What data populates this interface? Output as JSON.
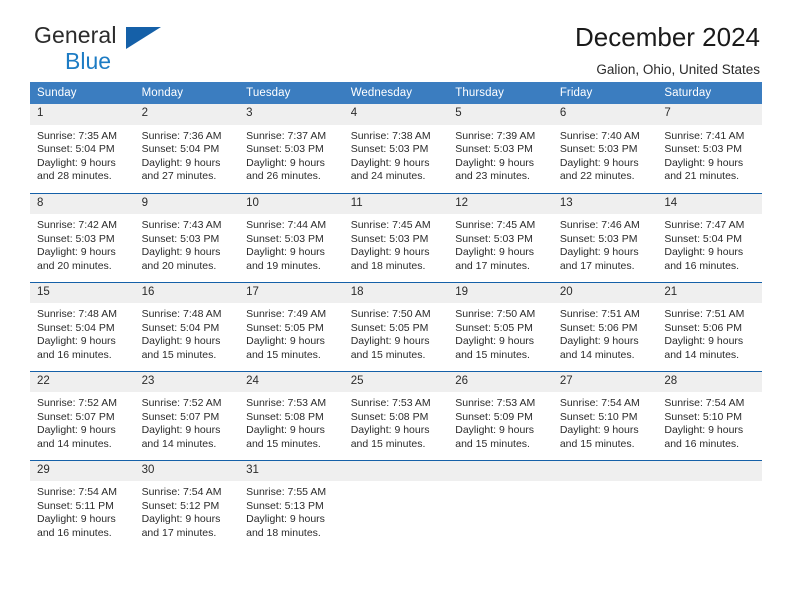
{
  "brand": {
    "name_part1": "General",
    "name_part2": "Blue",
    "triangle_color": "#1560a8",
    "blue_text_color": "#1d7cc4"
  },
  "header": {
    "title": "December 2024",
    "subtitle": "Galion, Ohio, United States"
  },
  "theme": {
    "header_row_bg": "#3b7dc0",
    "header_row_text": "#ffffff",
    "row_separator": "#1560a8",
    "daynum_bg": "#efefef"
  },
  "weekday_headers": [
    "Sunday",
    "Monday",
    "Tuesday",
    "Wednesday",
    "Thursday",
    "Friday",
    "Saturday"
  ],
  "labels": {
    "sunrise": "Sunrise:",
    "sunset": "Sunset:",
    "daylight": "Daylight:"
  },
  "weeks": [
    [
      {
        "day": "1",
        "sunrise": "Sunrise: 7:35 AM",
        "sunset": "Sunset: 5:04 PM",
        "daylight1": "Daylight: 9 hours",
        "daylight2": "and 28 minutes."
      },
      {
        "day": "2",
        "sunrise": "Sunrise: 7:36 AM",
        "sunset": "Sunset: 5:04 PM",
        "daylight1": "Daylight: 9 hours",
        "daylight2": "and 27 minutes."
      },
      {
        "day": "3",
        "sunrise": "Sunrise: 7:37 AM",
        "sunset": "Sunset: 5:03 PM",
        "daylight1": "Daylight: 9 hours",
        "daylight2": "and 26 minutes."
      },
      {
        "day": "4",
        "sunrise": "Sunrise: 7:38 AM",
        "sunset": "Sunset: 5:03 PM",
        "daylight1": "Daylight: 9 hours",
        "daylight2": "and 24 minutes."
      },
      {
        "day": "5",
        "sunrise": "Sunrise: 7:39 AM",
        "sunset": "Sunset: 5:03 PM",
        "daylight1": "Daylight: 9 hours",
        "daylight2": "and 23 minutes."
      },
      {
        "day": "6",
        "sunrise": "Sunrise: 7:40 AM",
        "sunset": "Sunset: 5:03 PM",
        "daylight1": "Daylight: 9 hours",
        "daylight2": "and 22 minutes."
      },
      {
        "day": "7",
        "sunrise": "Sunrise: 7:41 AM",
        "sunset": "Sunset: 5:03 PM",
        "daylight1": "Daylight: 9 hours",
        "daylight2": "and 21 minutes."
      }
    ],
    [
      {
        "day": "8",
        "sunrise": "Sunrise: 7:42 AM",
        "sunset": "Sunset: 5:03 PM",
        "daylight1": "Daylight: 9 hours",
        "daylight2": "and 20 minutes."
      },
      {
        "day": "9",
        "sunrise": "Sunrise: 7:43 AM",
        "sunset": "Sunset: 5:03 PM",
        "daylight1": "Daylight: 9 hours",
        "daylight2": "and 20 minutes."
      },
      {
        "day": "10",
        "sunrise": "Sunrise: 7:44 AM",
        "sunset": "Sunset: 5:03 PM",
        "daylight1": "Daylight: 9 hours",
        "daylight2": "and 19 minutes."
      },
      {
        "day": "11",
        "sunrise": "Sunrise: 7:45 AM",
        "sunset": "Sunset: 5:03 PM",
        "daylight1": "Daylight: 9 hours",
        "daylight2": "and 18 minutes."
      },
      {
        "day": "12",
        "sunrise": "Sunrise: 7:45 AM",
        "sunset": "Sunset: 5:03 PM",
        "daylight1": "Daylight: 9 hours",
        "daylight2": "and 17 minutes."
      },
      {
        "day": "13",
        "sunrise": "Sunrise: 7:46 AM",
        "sunset": "Sunset: 5:03 PM",
        "daylight1": "Daylight: 9 hours",
        "daylight2": "and 17 minutes."
      },
      {
        "day": "14",
        "sunrise": "Sunrise: 7:47 AM",
        "sunset": "Sunset: 5:04 PM",
        "daylight1": "Daylight: 9 hours",
        "daylight2": "and 16 minutes."
      }
    ],
    [
      {
        "day": "15",
        "sunrise": "Sunrise: 7:48 AM",
        "sunset": "Sunset: 5:04 PM",
        "daylight1": "Daylight: 9 hours",
        "daylight2": "and 16 minutes."
      },
      {
        "day": "16",
        "sunrise": "Sunrise: 7:48 AM",
        "sunset": "Sunset: 5:04 PM",
        "daylight1": "Daylight: 9 hours",
        "daylight2": "and 15 minutes."
      },
      {
        "day": "17",
        "sunrise": "Sunrise: 7:49 AM",
        "sunset": "Sunset: 5:05 PM",
        "daylight1": "Daylight: 9 hours",
        "daylight2": "and 15 minutes."
      },
      {
        "day": "18",
        "sunrise": "Sunrise: 7:50 AM",
        "sunset": "Sunset: 5:05 PM",
        "daylight1": "Daylight: 9 hours",
        "daylight2": "and 15 minutes."
      },
      {
        "day": "19",
        "sunrise": "Sunrise: 7:50 AM",
        "sunset": "Sunset: 5:05 PM",
        "daylight1": "Daylight: 9 hours",
        "daylight2": "and 15 minutes."
      },
      {
        "day": "20",
        "sunrise": "Sunrise: 7:51 AM",
        "sunset": "Sunset: 5:06 PM",
        "daylight1": "Daylight: 9 hours",
        "daylight2": "and 14 minutes."
      },
      {
        "day": "21",
        "sunrise": "Sunrise: 7:51 AM",
        "sunset": "Sunset: 5:06 PM",
        "daylight1": "Daylight: 9 hours",
        "daylight2": "and 14 minutes."
      }
    ],
    [
      {
        "day": "22",
        "sunrise": "Sunrise: 7:52 AM",
        "sunset": "Sunset: 5:07 PM",
        "daylight1": "Daylight: 9 hours",
        "daylight2": "and 14 minutes."
      },
      {
        "day": "23",
        "sunrise": "Sunrise: 7:52 AM",
        "sunset": "Sunset: 5:07 PM",
        "daylight1": "Daylight: 9 hours",
        "daylight2": "and 14 minutes."
      },
      {
        "day": "24",
        "sunrise": "Sunrise: 7:53 AM",
        "sunset": "Sunset: 5:08 PM",
        "daylight1": "Daylight: 9 hours",
        "daylight2": "and 15 minutes."
      },
      {
        "day": "25",
        "sunrise": "Sunrise: 7:53 AM",
        "sunset": "Sunset: 5:08 PM",
        "daylight1": "Daylight: 9 hours",
        "daylight2": "and 15 minutes."
      },
      {
        "day": "26",
        "sunrise": "Sunrise: 7:53 AM",
        "sunset": "Sunset: 5:09 PM",
        "daylight1": "Daylight: 9 hours",
        "daylight2": "and 15 minutes."
      },
      {
        "day": "27",
        "sunrise": "Sunrise: 7:54 AM",
        "sunset": "Sunset: 5:10 PM",
        "daylight1": "Daylight: 9 hours",
        "daylight2": "and 15 minutes."
      },
      {
        "day": "28",
        "sunrise": "Sunrise: 7:54 AM",
        "sunset": "Sunset: 5:10 PM",
        "daylight1": "Daylight: 9 hours",
        "daylight2": "and 16 minutes."
      }
    ],
    [
      {
        "day": "29",
        "sunrise": "Sunrise: 7:54 AM",
        "sunset": "Sunset: 5:11 PM",
        "daylight1": "Daylight: 9 hours",
        "daylight2": "and 16 minutes."
      },
      {
        "day": "30",
        "sunrise": "Sunrise: 7:54 AM",
        "sunset": "Sunset: 5:12 PM",
        "daylight1": "Daylight: 9 hours",
        "daylight2": "and 17 minutes."
      },
      {
        "day": "31",
        "sunrise": "Sunrise: 7:55 AM",
        "sunset": "Sunset: 5:13 PM",
        "daylight1": "Daylight: 9 hours",
        "daylight2": "and 18 minutes."
      },
      {
        "day": "",
        "sunrise": "",
        "sunset": "",
        "daylight1": "",
        "daylight2": ""
      },
      {
        "day": "",
        "sunrise": "",
        "sunset": "",
        "daylight1": "",
        "daylight2": ""
      },
      {
        "day": "",
        "sunrise": "",
        "sunset": "",
        "daylight1": "",
        "daylight2": ""
      },
      {
        "day": "",
        "sunrise": "",
        "sunset": "",
        "daylight1": "",
        "daylight2": ""
      }
    ]
  ]
}
